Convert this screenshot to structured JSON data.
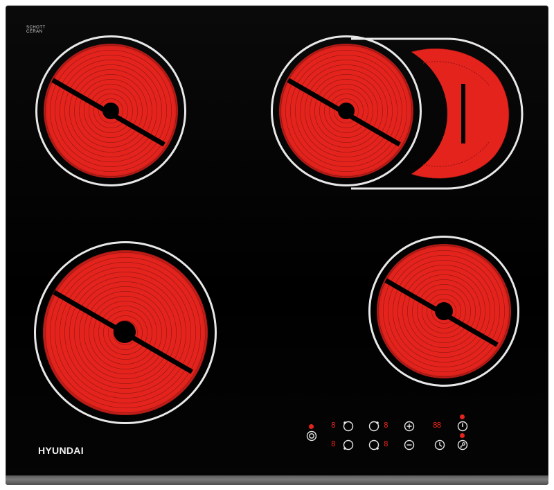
{
  "product": {
    "brand": "HYUNDAI",
    "glass_brand_line1": "SCHOTT",
    "glass_brand_line2": "CERAN"
  },
  "colors": {
    "glass": "#000000",
    "heating_element": "#e4231d",
    "ring": "#e8e8e8",
    "indicator": "#e4231d",
    "frame": "#6b6b6b"
  },
  "zones": [
    {
      "name": "rear-left",
      "type": "single"
    },
    {
      "name": "rear-right",
      "type": "dual-extension"
    },
    {
      "name": "front-left",
      "type": "single-large"
    },
    {
      "name": "front-right",
      "type": "single"
    }
  ],
  "controls": {
    "displays": [
      "8",
      "8",
      "8",
      "8",
      "88"
    ],
    "icons": [
      "zone-selector-icon",
      "zone-selector-icon",
      "zone-selector-icon",
      "zone-selector-icon",
      "plus-icon",
      "minus-icon",
      "power-icon",
      "timer-icon",
      "lock-icon",
      "extension-icon"
    ]
  }
}
